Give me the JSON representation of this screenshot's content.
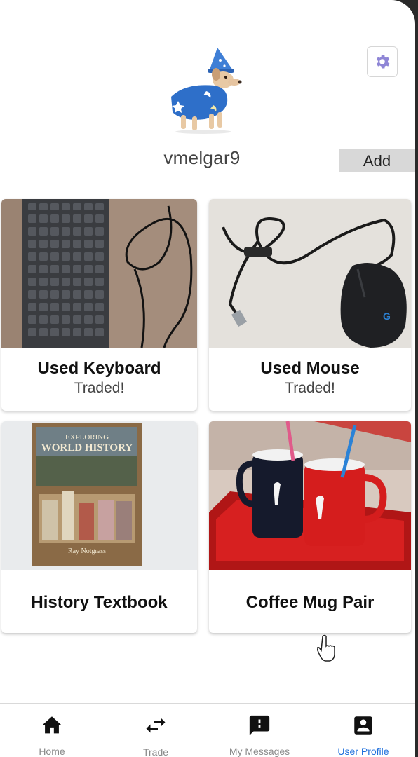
{
  "profile": {
    "username": "vmelgar9",
    "add_label": "Add"
  },
  "icons": {
    "settings": "gear-icon",
    "home": "home-icon",
    "trade": "swap-arrows-icon",
    "messages": "message-alert-icon",
    "profile": "account-box-icon"
  },
  "colors": {
    "active_nav": "#1e6fdc",
    "inactive_nav": "#8a8a8a",
    "settings_gear": "#8f86d6",
    "add_button_bg": "#d8d8d8"
  },
  "items": [
    {
      "title": "Used Keyboard",
      "status": "Traded!"
    },
    {
      "title": "Used Mouse",
      "status": "Traded!"
    },
    {
      "title": "History Textbook",
      "status": ""
    },
    {
      "title": "Coffee Mug Pair",
      "status": ""
    }
  ],
  "book_cover": {
    "line1": "EXPLORING",
    "line2": "WORLD HISTORY",
    "author": "Ray Notgrass"
  },
  "nav": [
    {
      "label": "Home",
      "active": false
    },
    {
      "label": "Trade",
      "active": false
    },
    {
      "label": "My Messages",
      "active": false
    },
    {
      "label": "User Profile",
      "active": true
    }
  ]
}
